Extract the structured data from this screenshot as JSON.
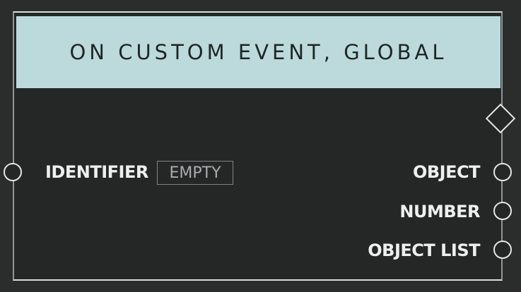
{
  "node": {
    "title": "ON CUSTOM EVENT, GLOBAL"
  },
  "inputs": [
    {
      "label": "IDENTIFIER",
      "value": "EMPTY"
    }
  ],
  "outputs": [
    {
      "label": "OBJECT"
    },
    {
      "label": "NUMBER"
    },
    {
      "label": "OBJECT LIST"
    }
  ],
  "colors": {
    "background": "#2b2d2d",
    "node_body": "#252727",
    "header": "#bcdadb",
    "header_text": "#1f2626",
    "label_text": "#eef0f0",
    "placeholder_text": "#a7acac"
  }
}
